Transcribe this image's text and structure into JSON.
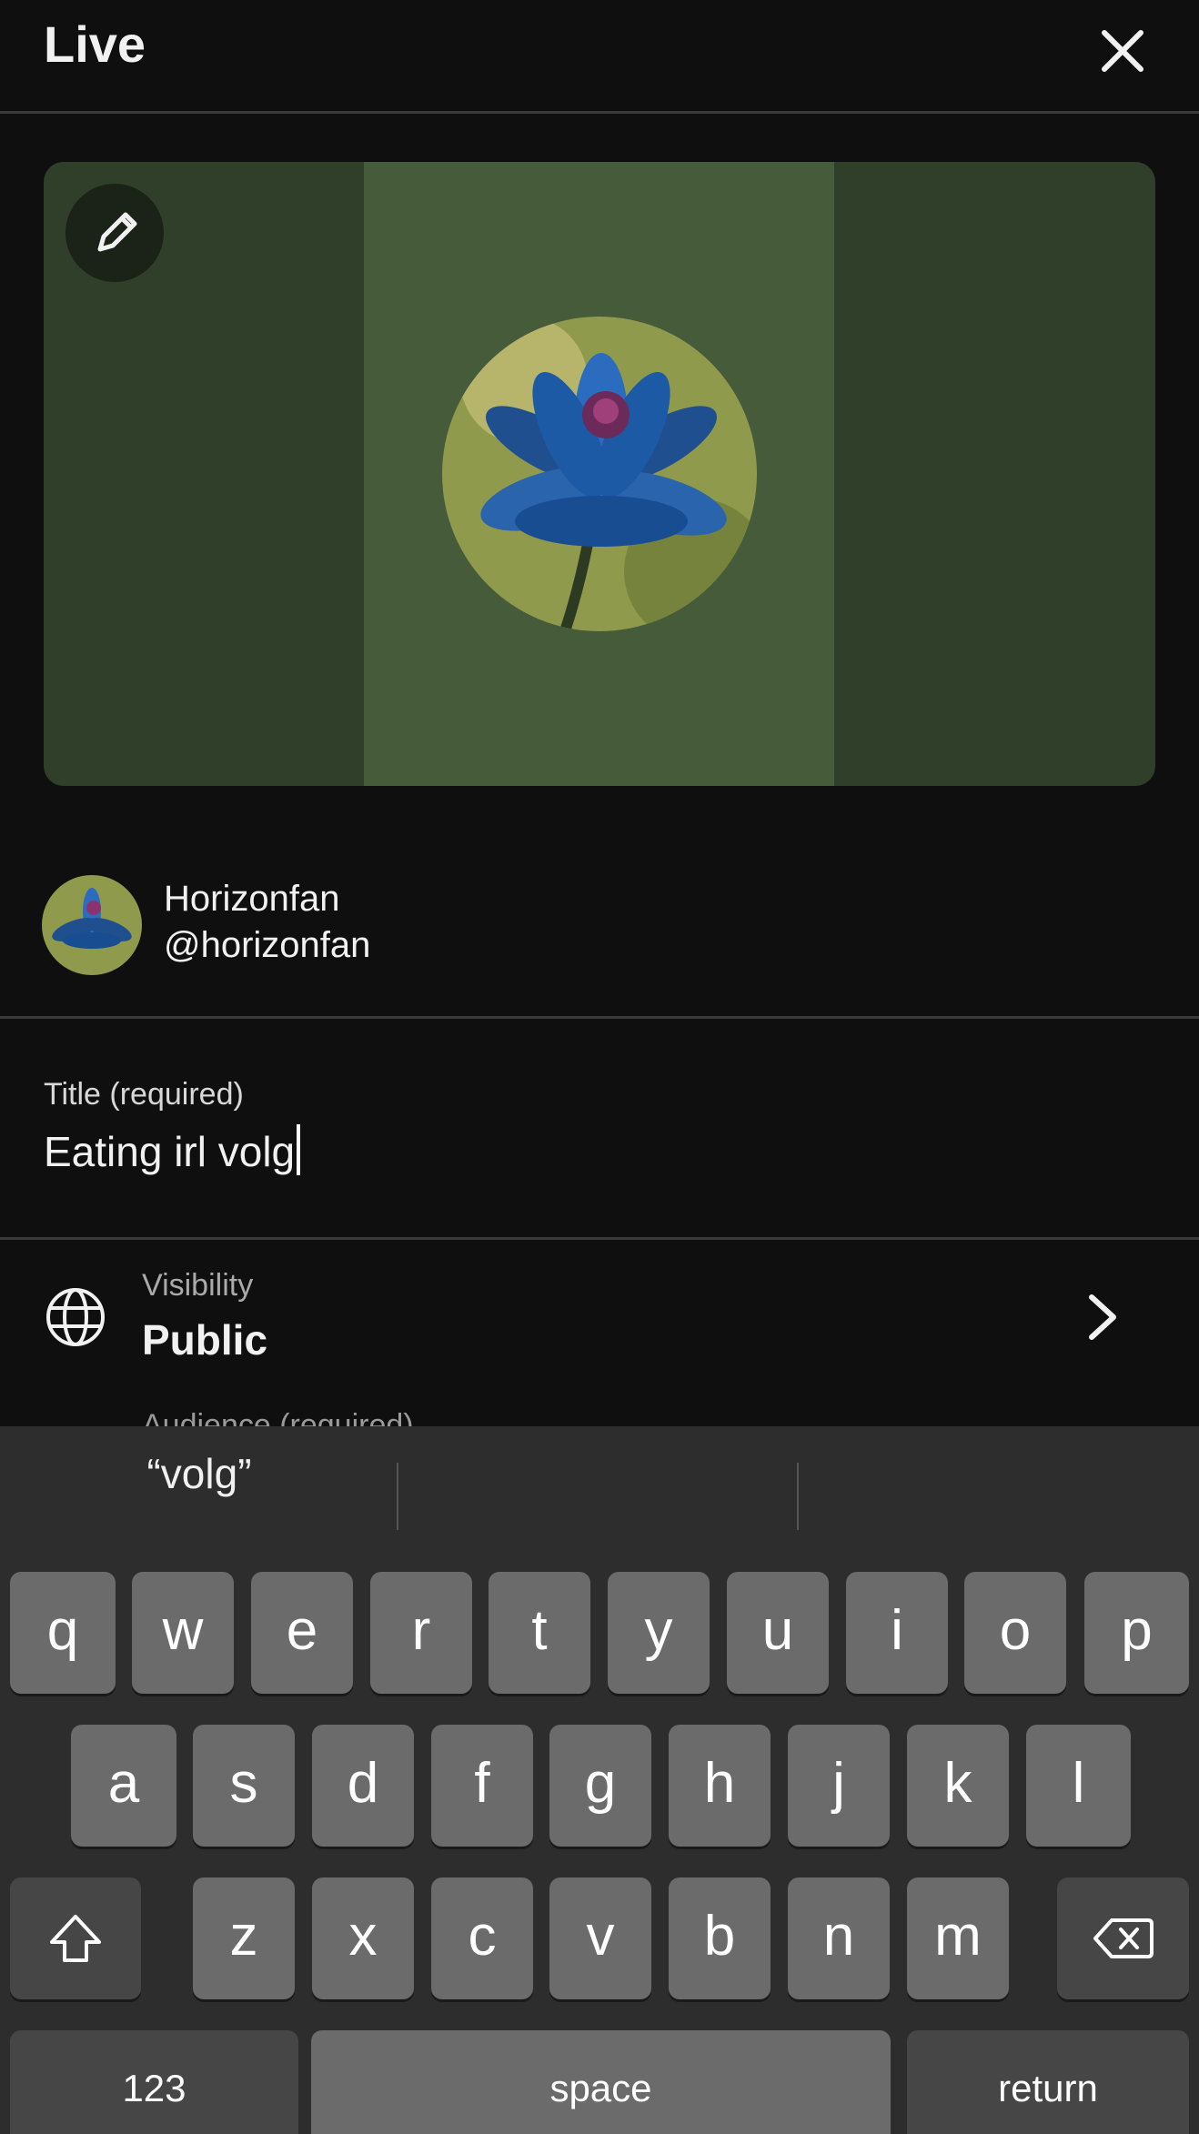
{
  "header": {
    "title": "Live",
    "close_icon": "close-icon"
  },
  "preview": {
    "edit_icon": "pencil-icon",
    "image": "blue lotus painting"
  },
  "channel": {
    "name": "Horizonfan",
    "handle": "@horizonfan"
  },
  "title_field": {
    "label": "Title (required)",
    "value": "Eating irl volg"
  },
  "visibility": {
    "label": "Visibility",
    "value": "Public",
    "icon": "globe-icon"
  },
  "audience_peek": "Audience (required)",
  "keyboard": {
    "suggestions": [
      "“volg”",
      "",
      ""
    ],
    "row1": [
      "q",
      "w",
      "e",
      "r",
      "t",
      "y",
      "u",
      "i",
      "o",
      "p"
    ],
    "row2": [
      "a",
      "s",
      "d",
      "f",
      "g",
      "h",
      "j",
      "k",
      "l"
    ],
    "row3": [
      "z",
      "x",
      "c",
      "v",
      "b",
      "n",
      "m"
    ],
    "numbers_key": "123",
    "space_key": "space",
    "return_key": "return"
  },
  "colors": {
    "background": "#0f0f0f",
    "preview_side": "#2f3f29",
    "preview_center": "#455b3a",
    "keyboard": "#2d2d2d",
    "key": "#6b6b6b"
  }
}
